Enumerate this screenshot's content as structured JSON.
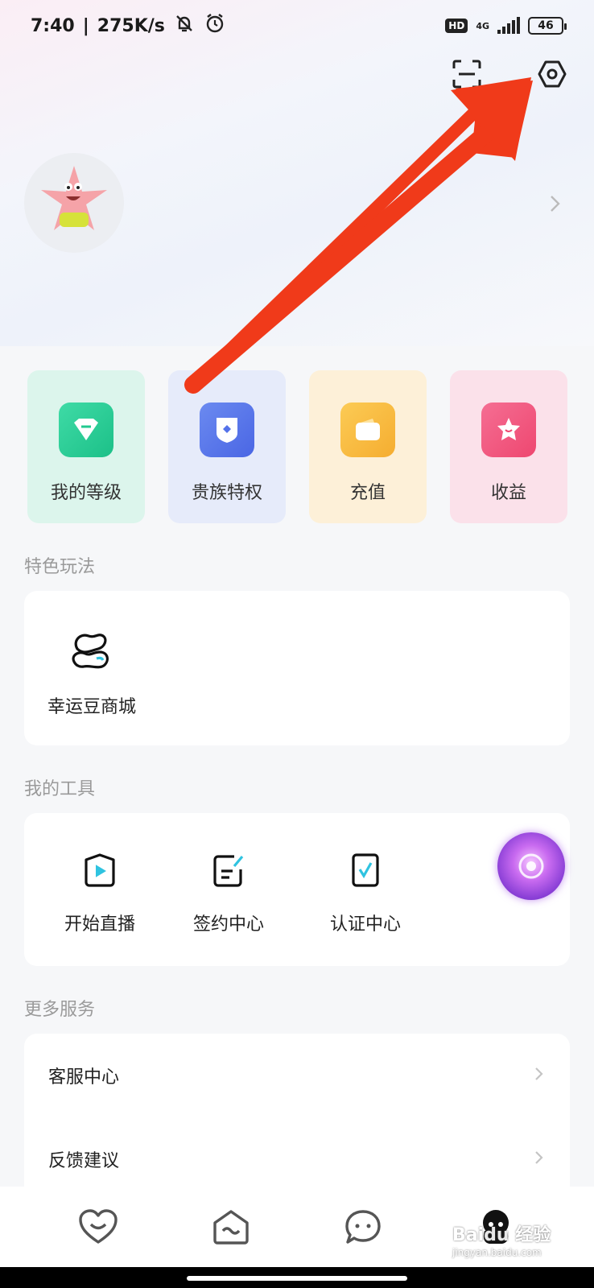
{
  "status_bar": {
    "time": "7:40",
    "separator": "|",
    "net_speed": "275K/s",
    "hd_label": "HD",
    "network_type": "4G",
    "battery_level": "46"
  },
  "header": {
    "scan_icon": "scan-icon",
    "settings_icon": "settings-icon"
  },
  "quick_cards": [
    {
      "label": "我的等级",
      "icon": "diamond-icon",
      "bg": "#dcf5ec",
      "icon_color": "#22c98f"
    },
    {
      "label": "贵族特权",
      "icon": "shield-icon",
      "bg": "#e6ebfa",
      "icon_color": "#5472ea"
    },
    {
      "label": "充值",
      "icon": "wallet-icon",
      "bg": "#fdf0d8",
      "icon_color": "#f7b840"
    },
    {
      "label": "收益",
      "icon": "star-badge-icon",
      "bg": "#fbe1ea",
      "icon_color": "#f2587e"
    }
  ],
  "sections": {
    "features_title": "特色玩法",
    "tools_title": "我的工具",
    "services_title": "更多服务"
  },
  "features": [
    {
      "label": "幸运豆商城",
      "icon": "beans-icon"
    }
  ],
  "tools": [
    {
      "label": "开始直播",
      "icon": "live-play-icon"
    },
    {
      "label": "签约中心",
      "icon": "contract-icon"
    },
    {
      "label": "认证中心",
      "icon": "verify-icon"
    }
  ],
  "services": [
    {
      "label": "客服中心"
    },
    {
      "label": "反馈建议"
    }
  ],
  "tabs": [
    {
      "icon": "heart-smile-icon"
    },
    {
      "icon": "home-icon"
    },
    {
      "icon": "chat-icon"
    },
    {
      "icon": "profile-icon"
    }
  ],
  "watermark": {
    "brand": "Baidu 经验",
    "url": "jingyan.baidu.com"
  }
}
